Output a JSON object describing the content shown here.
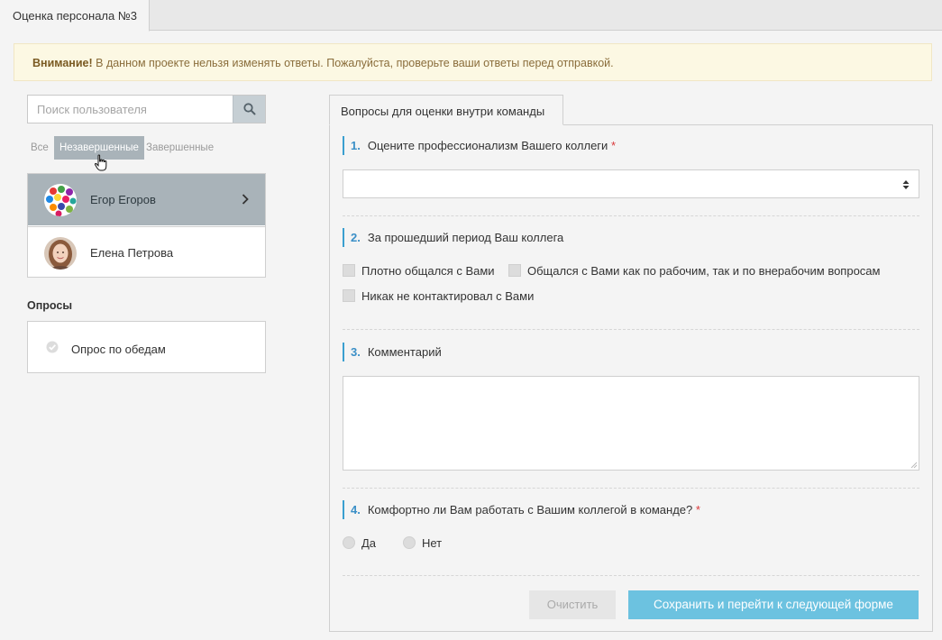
{
  "tabs": {
    "active_tab": "Оценка персонала №3"
  },
  "alert": {
    "strong": "Внимание!",
    "text": " В данном проекте нельзя изменять ответы. Пожалуйста, проверьте ваши ответы перед отправкой."
  },
  "search": {
    "placeholder": "Поиск пользователя",
    "value": "",
    "icon": "search-icon"
  },
  "filters": [
    {
      "label": "Все",
      "active": false
    },
    {
      "label": "Незавершенные",
      "active": true
    },
    {
      "label": "Завершенные",
      "active": false
    }
  ],
  "users": [
    {
      "name": "Егор Егоров",
      "selected": true
    },
    {
      "name": "Елена Петрова",
      "selected": false
    }
  ],
  "surveys": {
    "title": "Опросы",
    "items": [
      {
        "label": "Опрос по обедам",
        "icon": "check-circle-icon"
      }
    ]
  },
  "form": {
    "tab": "Вопросы для оценки внутри команды",
    "questions": [
      {
        "number": "1.",
        "text": "Оцените профессионализм Вашего коллеги",
        "required": "*",
        "type": "select",
        "value": ""
      },
      {
        "number": "2.",
        "text": "За прошедший период Ваш коллега",
        "type": "checkbox",
        "options": [
          "Плотно общался с Вами",
          "Общался с Вами как по рабочим, так и по внерабочим вопросам",
          "Никак не контактировал с Вами"
        ]
      },
      {
        "number": "3.",
        "text": "Комментарий",
        "type": "textarea",
        "value": ""
      },
      {
        "number": "4.",
        "text": "Комфортно ли Вам работать с Вашим коллегой в команде?",
        "required": "*",
        "type": "radio",
        "options": [
          "Да",
          "Нет"
        ]
      }
    ],
    "buttons": {
      "clear": "Очистить",
      "save": "Сохранить и перейти к следующей форме"
    }
  },
  "colors": {
    "accent": "#3a9fd0",
    "save_button": "#6cc2e0",
    "selected_row": "#a9b3b9",
    "alert_bg": "#fcf8e3",
    "required": "#d9383a"
  }
}
